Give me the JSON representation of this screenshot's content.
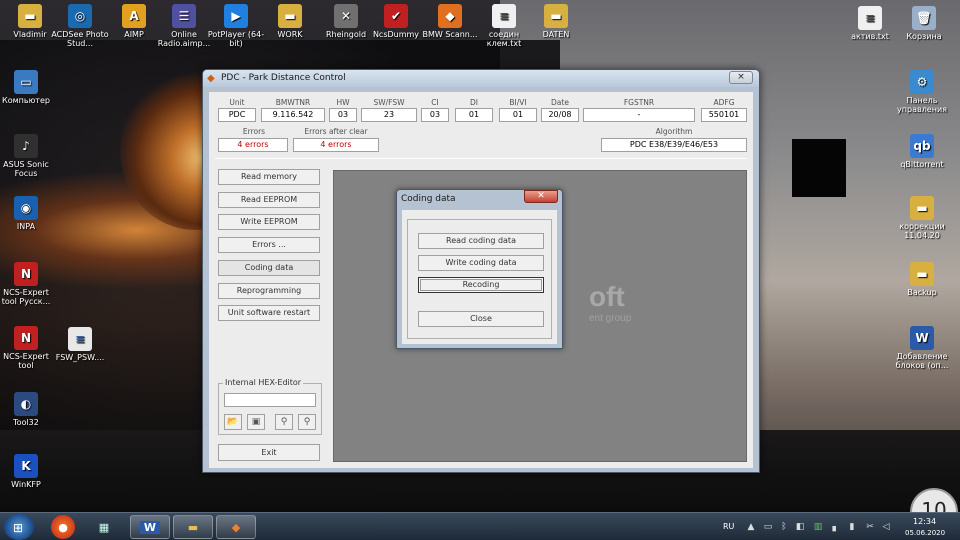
{
  "desktop_left": [
    {
      "label": "Vladimir",
      "icon": "folder-icon",
      "color": "#d8b040",
      "glyph": "▬"
    },
    {
      "label": "ACDSee Photo Stud...",
      "icon": "acdsee-icon",
      "color": "#1a6ab0",
      "glyph": "◎"
    },
    {
      "label": "AIMP",
      "icon": "aimp-icon",
      "color": "#e0a020",
      "glyph": "A"
    },
    {
      "label": "Online Radio.aimp...",
      "icon": "radio-icon",
      "color": "#5050a0",
      "glyph": "☰"
    },
    {
      "label": "PotPlayer (64-bit)",
      "icon": "potplayer-icon",
      "color": "#2080e0",
      "glyph": "▶"
    },
    {
      "label": "WORK",
      "icon": "folder-icon",
      "color": "#d8b040",
      "glyph": "▬"
    },
    {
      "label": "Rheingold",
      "icon": "rheingold-icon",
      "color": "#707070",
      "glyph": "✕"
    },
    {
      "label": "NcsDummy",
      "icon": "ncsdummy-icon",
      "color": "#c02020",
      "glyph": "✔"
    },
    {
      "label": "BMW Scann...",
      "icon": "bmw-scanner-icon",
      "color": "#e07020",
      "glyph": "◆"
    },
    {
      "label": "соедин клем.txt",
      "icon": "text-file-icon",
      "color": "#f0f0f0",
      "glyph": "≡"
    },
    {
      "label": "DATEN",
      "icon": "folder-icon",
      "color": "#d8b040",
      "glyph": "▬"
    }
  ],
  "desktop_col": [
    {
      "label": "Компьютер",
      "icon": "computer-icon",
      "color": "#3a7ac0",
      "glyph": "▭"
    },
    {
      "label": "ASUS Sonic Focus",
      "icon": "asus-icon",
      "color": "#303030",
      "glyph": "♪"
    },
    {
      "label": "INPA",
      "icon": "inpa-icon",
      "color": "#1a60b0",
      "glyph": "◉"
    },
    {
      "label": "NCS-Expert tool Русск...",
      "icon": "ncs-expert-icon",
      "color": "#c02020",
      "glyph": "N"
    },
    {
      "label": "NCS-Expert tool",
      "icon": "ncs-expert-icon",
      "color": "#c02020",
      "glyph": "N"
    },
    {
      "label": "Tool32",
      "icon": "tool32-icon",
      "color": "#2a4a80",
      "glyph": "◐"
    },
    {
      "label": "WinKFP",
      "icon": "winkfp-icon",
      "color": "#1a50c0",
      "glyph": "K"
    }
  ],
  "desktop_extra": {
    "label": "FSW_PSW....",
    "icon": "document-icon",
    "color": "#e8e8e8",
    "glyph": "≡"
  },
  "desktop_right": [
    {
      "label": "актив.txt",
      "icon": "text-file-icon",
      "color": "#f0f0f0",
      "glyph": "≡"
    },
    {
      "label": "Корзина",
      "icon": "recycle-bin-icon",
      "color": "#9ab0c8",
      "glyph": "🗑"
    },
    {
      "label": "Панель управления",
      "icon": "control-panel-icon",
      "color": "#3a8ad0",
      "glyph": "⚙"
    },
    {
      "label": "qBittorrent",
      "icon": "qbittorrent-icon",
      "color": "#3a7ad0",
      "glyph": "qb"
    },
    {
      "label": "коррекции 11.04.20",
      "icon": "folder-icon",
      "color": "#d8b040",
      "glyph": "▬"
    },
    {
      "label": "Backup",
      "icon": "folder-icon",
      "color": "#d8b040",
      "glyph": "▬"
    },
    {
      "label": "Добавление блоков (оп...",
      "icon": "word-doc-icon",
      "color": "#2a5aa8",
      "glyph": "W"
    }
  ],
  "window": {
    "title": "PDC - Park Distance Control",
    "close": "×",
    "headers": [
      "Unit name",
      "BMWTNR",
      "HW",
      "SW/FSW",
      "CI",
      "DI",
      "BI/VI",
      "Date",
      "FGSTNR",
      "ADFG"
    ],
    "values": [
      "PDC",
      "9.116.542",
      "03",
      "23",
      "03",
      "01",
      "01",
      "20/08",
      "-",
      "550101"
    ],
    "errors_label": "Errors",
    "errors_value": "4 errors",
    "errors_after_label": "Errors after clear",
    "errors_after_value": "4 errors",
    "algorithm_label": "Algorithm",
    "algorithm_value": "PDC E38/E39/E46/E53",
    "side_buttons": [
      "Read memory",
      "Read EEPROM",
      "Write EEPROM",
      "Errors ...",
      "Coding data",
      "Reprogramming",
      "Unit software restart"
    ],
    "hex_editor_label": "Internal HEX-Editor",
    "exit_label": "Exit",
    "watermark_big": "oft",
    "watermark_small": "ent group"
  },
  "dialog": {
    "title": "Coding data",
    "close": "✕",
    "buttons": [
      "Read coding data",
      "Write coding data",
      "Recoding",
      "Close"
    ]
  },
  "corner_badge": "10",
  "taskbar": {
    "lang": "RU",
    "time": "12:34",
    "date": "05.06.2020"
  }
}
